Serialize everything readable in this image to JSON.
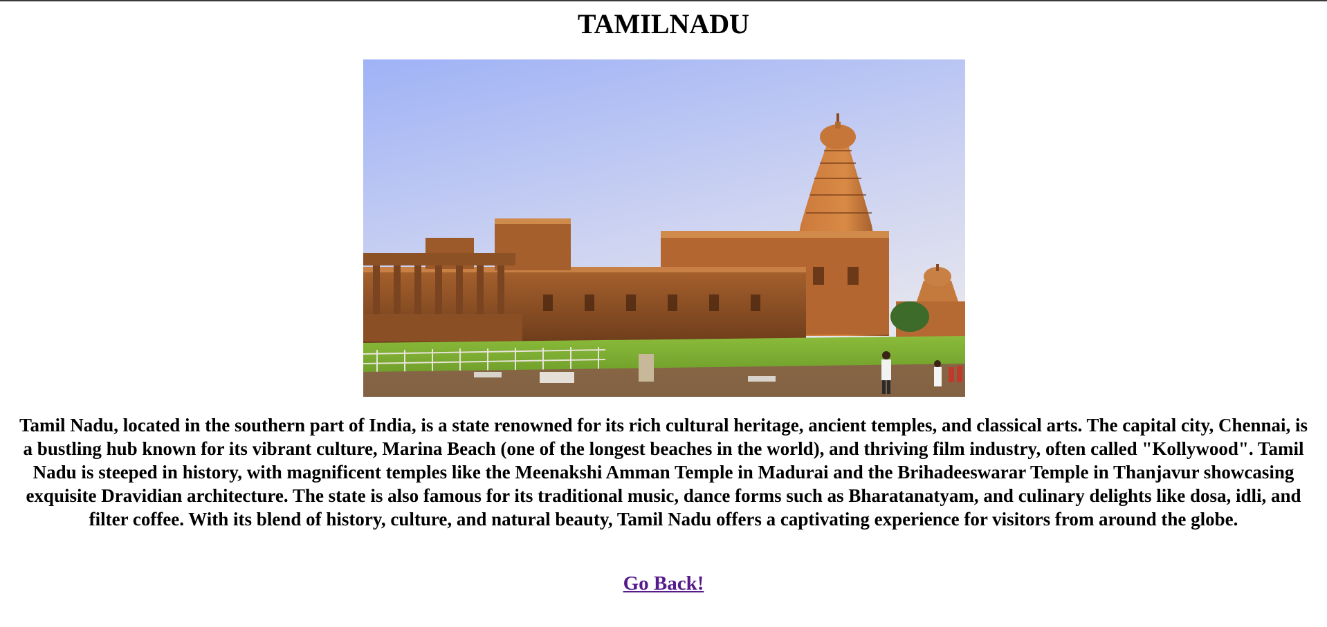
{
  "page": {
    "title": "TAMILNADU",
    "description": "Tamil Nadu, located in the southern part of India, is a state renowned for its rich cultural heritage, ancient temples, and classical arts. The capital city, Chennai, is a bustling hub known for its vibrant culture, Marina Beach (one of the longest beaches in the world), and thriving film industry, often called \"Kollywood\". Tamil Nadu is steeped in history, with magnificent temples like the Meenakshi Amman Temple in Madurai and the Brihadeeswarar Temple in Thanjavur showcasing exquisite Dravidian architecture. The state is also famous for its traditional music, dance forms such as Bharatanatyam, and culinary delights like dosa, idli, and filter coffee. With its blend of history, culture, and natural beauty, Tamil Nadu offers a captivating experience for visitors from around the globe.",
    "back_link_label": "Go Back!"
  },
  "colors": {
    "link_visited": "#551a8b",
    "sky_top": "#a9b8f4",
    "sky_bottom": "#e4e6f2",
    "stone": "#b86a2e",
    "lawn": "#7fae33"
  }
}
